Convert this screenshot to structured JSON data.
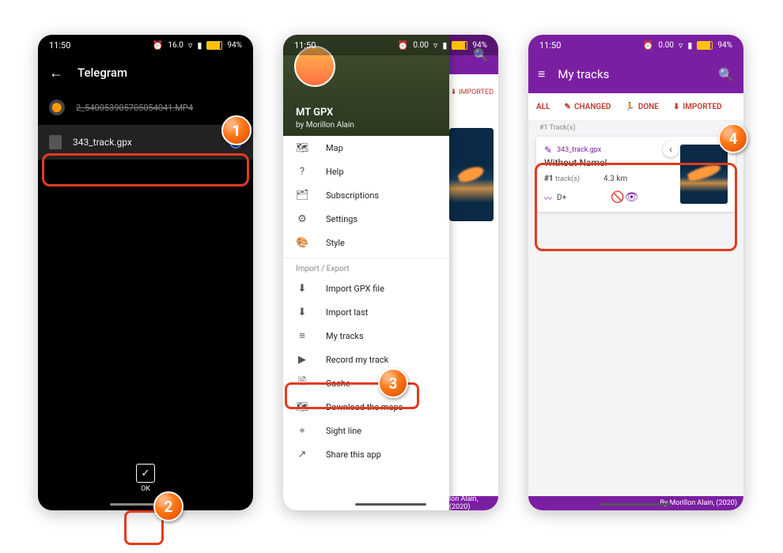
{
  "status": {
    "time": "11:50",
    "net": "16.0",
    "battery": "94%"
  },
  "phone1": {
    "app": "Telegram",
    "file_strike": "2_540053905705054041.MP4",
    "file_selected": "343_track.gpx",
    "ok": "OK"
  },
  "phone2": {
    "header_title": "MT GPX",
    "header_sub": "by Morillon Alain",
    "items_main": [
      {
        "icon": "🗺",
        "label": "Map"
      },
      {
        "icon": "?",
        "label": "Help"
      },
      {
        "icon": "🗂",
        "label": "Subscriptions"
      },
      {
        "icon": "⚙",
        "label": "Settings"
      },
      {
        "icon": "🎨",
        "label": "Style"
      }
    ],
    "section": "Import / Export",
    "items_io": [
      {
        "icon": "⬇",
        "label": "Import GPX file"
      },
      {
        "icon": "⬇",
        "label": "Import last"
      },
      {
        "icon": "≡",
        "label": "My tracks"
      },
      {
        "icon": "▶",
        "label": "Record my track"
      },
      {
        "icon": "🗎",
        "label": "Cache"
      },
      {
        "icon": "🗺",
        "label": "Download the maps"
      },
      {
        "icon": "⌖",
        "label": "Sight line"
      },
      {
        "icon": "↗",
        "label": "Share this app"
      }
    ],
    "tab_imported": "IMPORTED",
    "footer": "lon Alain, (2020)"
  },
  "phone3": {
    "title": "My tracks",
    "tabs": {
      "all": "ALL",
      "changed": "CHANGED",
      "done": "DONE",
      "imported": "IMPORTED"
    },
    "count": "#1 Track(s)",
    "card": {
      "file": "343_track.gpx",
      "name": "Without Name!",
      "line_a": "#1",
      "line_a2": "track(s)",
      "dist": "4.3 km",
      "dplus": "D+"
    },
    "footer": "By Morillon Alain, (2020)"
  },
  "badges": {
    "b1": "1",
    "b2": "2",
    "b3": "3",
    "b4": "4"
  }
}
